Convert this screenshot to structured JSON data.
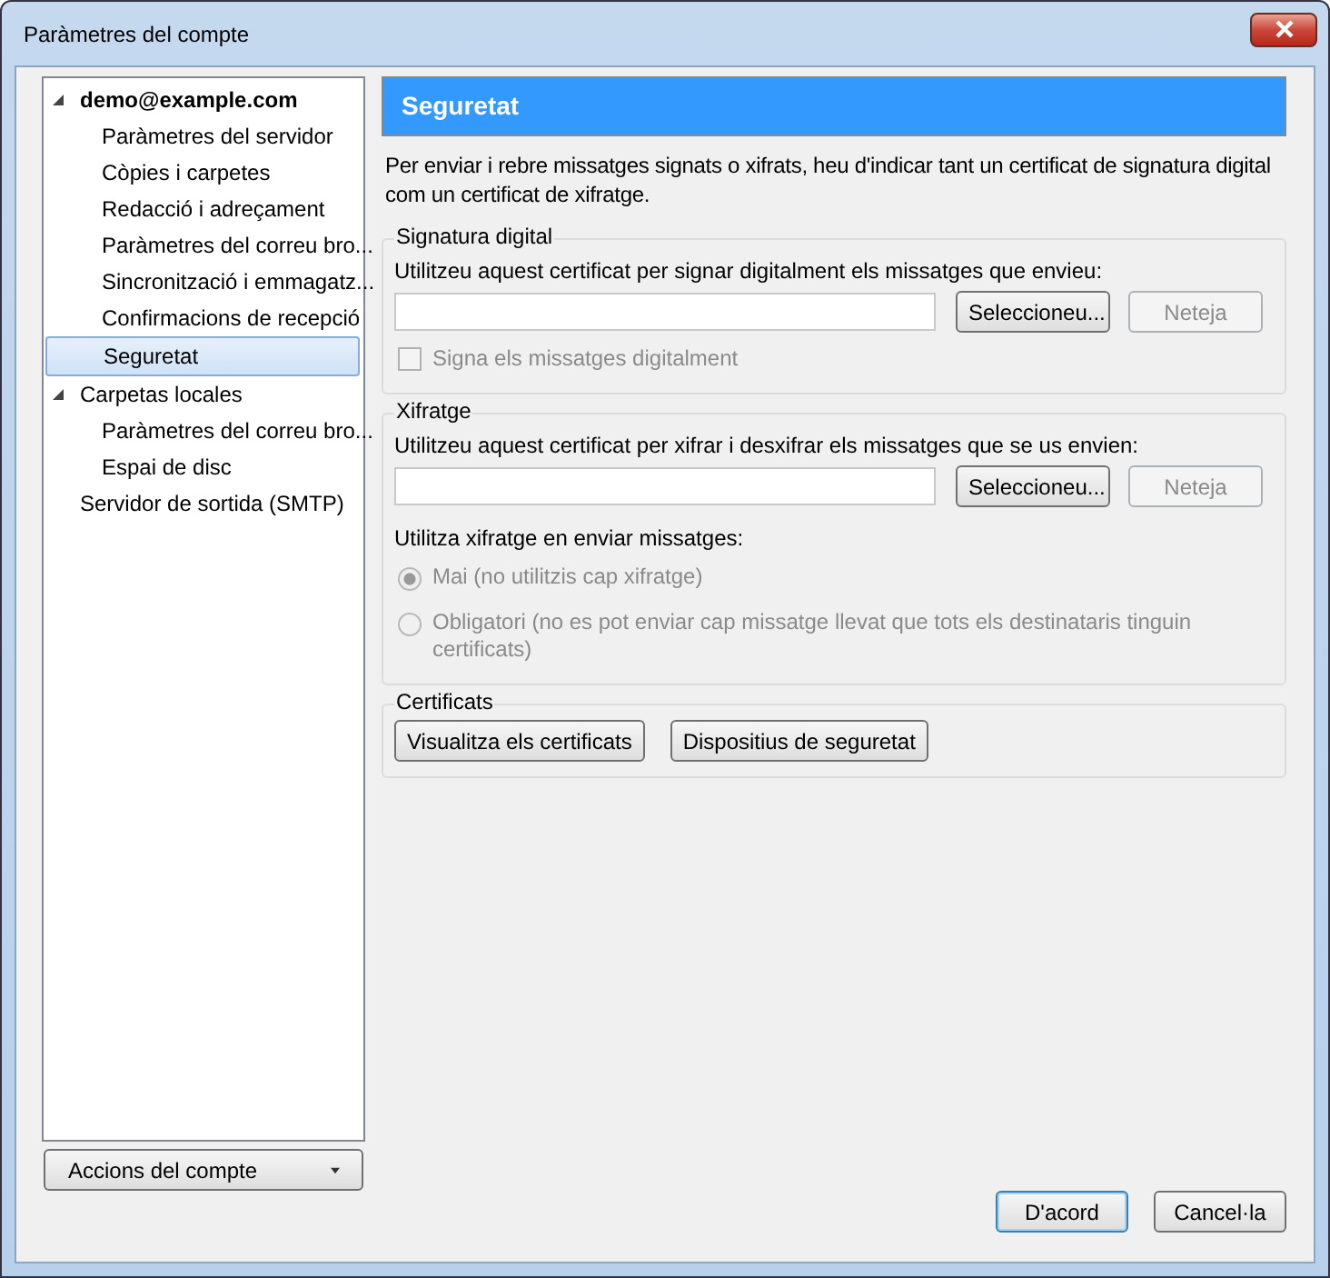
{
  "window": {
    "title": "Paràmetres del compte"
  },
  "tree": [
    {
      "label": "demo@example.com",
      "bold": true,
      "expanded": true,
      "selected": false,
      "children": [
        {
          "label": "Paràmetres del servidor",
          "selected": false
        },
        {
          "label": "Còpies i carpetes",
          "selected": false
        },
        {
          "label": "Redacció i adreçament",
          "selected": false
        },
        {
          "label": "Paràmetres del correu bro...",
          "selected": false
        },
        {
          "label": "Sincronització i emmagatz...",
          "selected": false
        },
        {
          "label": "Confirmacions de recepció",
          "selected": false
        },
        {
          "label": "Seguretat",
          "selected": true
        }
      ]
    },
    {
      "label": "Carpetas locales",
      "bold": false,
      "expanded": true,
      "selected": false,
      "children": [
        {
          "label": "Paràmetres del correu bro...",
          "selected": false
        },
        {
          "label": "Espai de disc",
          "selected": false
        }
      ]
    },
    {
      "label": "Servidor de sortida (SMTP)",
      "bold": false,
      "selected": false
    }
  ],
  "account_actions": {
    "label": "Accions del compte"
  },
  "page": {
    "heading": "Seguretat",
    "intro": "Per enviar i rebre missatges signats o xifrats, heu d'indicar tant un certificat de signatura digital com un certificat de xifratge.",
    "signing": {
      "legend": "Signatura digital",
      "label": "Utilitzeu aquest certificat per signar digitalment els missatges que envieu:",
      "buttons": [
        {
          "label": "Seleccioneu...",
          "disabled": false
        },
        {
          "label": "Neteja",
          "disabled": true
        }
      ],
      "checkbox": {
        "label": "Signa els missatges digitalment",
        "checked": false,
        "disabled": true
      }
    },
    "encryption": {
      "legend": "Xifratge",
      "label": "Utilitzeu aquest certificat per xifrar i desxifrar els missatges que se us envien:",
      "buttons": [
        {
          "label": "Seleccioneu...",
          "disabled": false
        },
        {
          "label": "Neteja",
          "disabled": true
        }
      ],
      "radio_label": "Utilitza xifratge en enviar missatges:",
      "radios": [
        {
          "label": "Mai (no utilitzis cap xifratge)",
          "selected": true,
          "disabled": true
        },
        {
          "label": "Obligatori (no es pot enviar cap missatge llevat que tots els destinataris tinguin certificats)",
          "selected": false,
          "disabled": true
        }
      ]
    },
    "certificates": {
      "legend": "Certificats",
      "buttons": [
        {
          "label": "Visualitza els certificats",
          "disabled": false
        },
        {
          "label": "Dispositius de seguretat",
          "disabled": false
        }
      ]
    }
  },
  "footer_buttons": [
    {
      "label": "D'acord",
      "default": true
    },
    {
      "label": "Cancel·la",
      "default": false
    }
  ]
}
